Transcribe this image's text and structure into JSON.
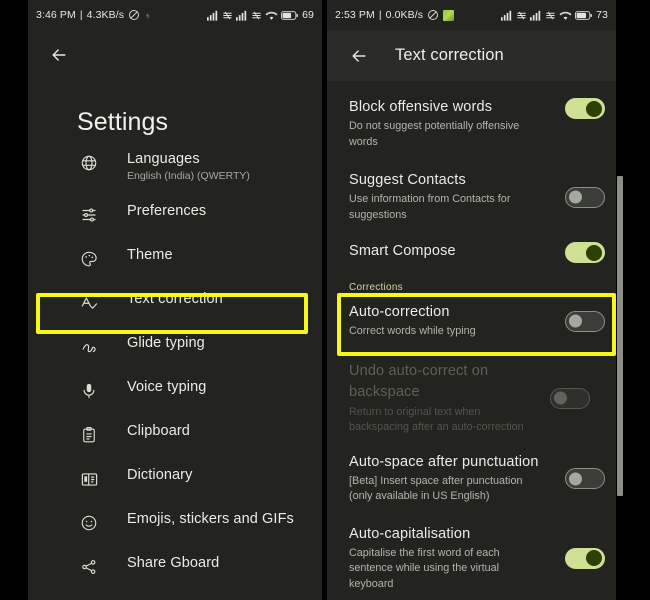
{
  "left_phone": {
    "statusbar": {
      "time": "3:46 PM",
      "separator": "|",
      "net_speed": "4.3KB/s",
      "dnd_icon": "do-not-disturb-icon",
      "extra_icon": "small-glyph-icon",
      "signal1_icon": "signal-bars-icon",
      "sim1_icon": "sim-network-icon",
      "signal2_icon": "signal-bars-icon",
      "sim2_icon": "sim-network-icon",
      "wifi_icon": "wifi-icon",
      "battery_icon": "battery-icon",
      "battery_pct": "69"
    },
    "back_icon": "back-arrow-icon",
    "page_title": "Settings",
    "items": [
      {
        "icon": "globe-icon",
        "label": "Languages",
        "sub": "English (India) (QWERTY)"
      },
      {
        "icon": "sliders-icon",
        "label": "Preferences",
        "sub": ""
      },
      {
        "icon": "palette-icon",
        "label": "Theme",
        "sub": ""
      },
      {
        "icon": "spellcheck-icon",
        "label": "Text correction",
        "sub": ""
      },
      {
        "icon": "glide-icon",
        "label": "Glide typing",
        "sub": ""
      },
      {
        "icon": "microphone-icon",
        "label": "Voice typing",
        "sub": ""
      },
      {
        "icon": "clipboard-icon",
        "label": "Clipboard",
        "sub": ""
      },
      {
        "icon": "dictionary-icon",
        "label": "Dictionary",
        "sub": ""
      },
      {
        "icon": "emoji-icon",
        "label": "Emojis, stickers and GIFs",
        "sub": ""
      },
      {
        "icon": "share-icon",
        "label": "Share Gboard",
        "sub": ""
      }
    ],
    "highlight_target": "Text correction",
    "highlight_color": "#f7f71a"
  },
  "right_phone": {
    "statusbar": {
      "time": "2:53 PM",
      "separator": "|",
      "net_speed": "0.0KB/s",
      "dnd_icon": "do-not-disturb-icon",
      "app_icon": "green-app-icon",
      "signal1_icon": "signal-bars-icon",
      "sim1_icon": "sim-network-icon",
      "signal2_icon": "signal-bars-icon",
      "sim2_icon": "sim-network-icon",
      "wifi_icon": "wifi-icon",
      "battery_icon": "battery-icon",
      "battery_pct": "73"
    },
    "back_icon": "back-arrow-icon",
    "page_title": "Text correction",
    "section_label": "Corrections",
    "items": [
      {
        "title": "Block offensive words",
        "sub": "Do not suggest potentially offensive words",
        "toggle": "on",
        "disabled": false
      },
      {
        "title": "Suggest Contacts",
        "sub": "Use information from Contacts for suggestions",
        "toggle": "off",
        "disabled": false
      },
      {
        "title": "Smart Compose",
        "sub": "",
        "toggle": "on",
        "disabled": false
      },
      {
        "title": "Auto-correction",
        "sub": "Correct words while typing",
        "toggle": "off",
        "disabled": false
      },
      {
        "title": "Undo auto-correct on backspace",
        "sub": "Return to original text when backspacing after an auto-correction",
        "toggle": "off",
        "disabled": true
      },
      {
        "title": "Auto-space after punctuation",
        "sub": "[Beta] Insert space after punctuation (only available in US English)",
        "toggle": "off",
        "disabled": false
      },
      {
        "title": "Auto-capitalisation",
        "sub": "Capitalise the first word of each sentence while using the virtual keyboard",
        "toggle": "on",
        "disabled": false
      }
    ],
    "highlight_target": "Auto-correction",
    "highlight_color": "#f7f71a",
    "scrollbar": "vertical-scrollbar"
  }
}
